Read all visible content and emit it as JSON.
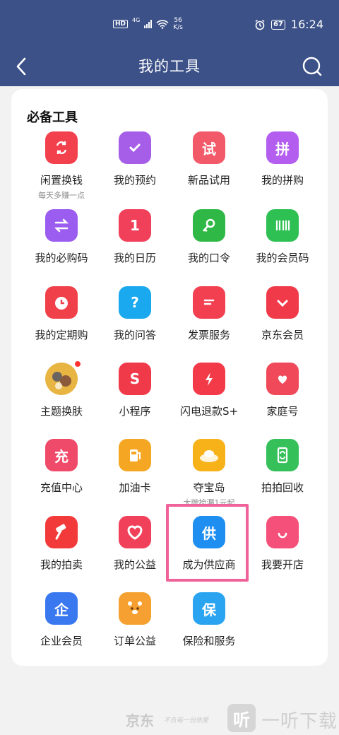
{
  "status_bar": {
    "hd": "HD",
    "network": "4G",
    "speed_value": "56",
    "speed_unit": "K/s",
    "battery": "67",
    "time": "16:24"
  },
  "nav": {
    "title": "我的工具",
    "back_icon": "chevron-left-icon",
    "search_icon": "search-icon",
    "bg_color": "#3c5188"
  },
  "section": {
    "title": "必备工具"
  },
  "tools": [
    {
      "label": "闲置换钱",
      "sub": "每天多赚一点",
      "icon": "recycle-bag-icon",
      "color": "#f2404d"
    },
    {
      "label": "我的预约",
      "icon": "calendar-check-icon",
      "color": "#a65ee8"
    },
    {
      "label": "新品试用",
      "glyph": "试",
      "icon": "trial-icon",
      "color": "#f25a6a"
    },
    {
      "label": "我的拼购",
      "glyph": "拼",
      "icon": "cart-icon",
      "color": "#b45ef0"
    },
    {
      "label": "我的必购码",
      "icon": "exchange-code-icon",
      "color": "#9b5cf0"
    },
    {
      "label": "我的日历",
      "glyph": "1",
      "icon": "calendar-icon",
      "color": "#f0405a"
    },
    {
      "label": "我的口令",
      "icon": "key-icon",
      "color": "#2fb845"
    },
    {
      "label": "我的会员码",
      "icon": "barcode-icon",
      "color": "#2fc054"
    },
    {
      "label": "我的定期购",
      "icon": "alarm-clock-icon",
      "color": "#f0404a"
    },
    {
      "label": "我的问答",
      "glyph": "?",
      "icon": "question-icon",
      "color": "#1aa8ee"
    },
    {
      "label": "发票服务",
      "icon": "invoice-icon",
      "color": "#f24050"
    },
    {
      "label": "京东会员",
      "icon": "heart-badge-icon",
      "color": "#f03a4a"
    },
    {
      "label": "主题换肤",
      "icon": "theme-avatar-icon",
      "color": "#e8b543"
    },
    {
      "label": "小程序",
      "glyph": "S",
      "icon": "mini-program-icon",
      "color": "#f03a4a"
    },
    {
      "label": "闪电退款S+",
      "icon": "lightning-shield-icon",
      "color": "#f23a48"
    },
    {
      "label": "家庭号",
      "icon": "home-heart-icon",
      "color": "#f04a5a"
    },
    {
      "label": "充值中心",
      "glyph": "充",
      "icon": "phone-recharge-icon",
      "color": "#f04a6a"
    },
    {
      "label": "加油卡",
      "icon": "fuel-pump-icon",
      "color": "#f5a623"
    },
    {
      "label": "夺宝岛",
      "sub": "大牌捡漏1元起",
      "icon": "gold-ingot-icon",
      "color": "#f7b21a"
    },
    {
      "label": "拍拍回收",
      "icon": "recycle-phone-icon",
      "color": "#35c05a"
    },
    {
      "label": "我的拍卖",
      "icon": "auction-hammer-icon",
      "color": "#f23a3a"
    },
    {
      "label": "我的公益",
      "icon": "charity-heart-icon",
      "color": "#f0405a"
    },
    {
      "label": "成为供应商",
      "glyph": "供",
      "icon": "supplier-icon",
      "color": "#1e8ef0"
    },
    {
      "label": "我要开店",
      "icon": "store-icon",
      "color": "#f5507a"
    },
    {
      "label": "企业会员",
      "glyph": "企",
      "icon": "enterprise-icon",
      "color": "#3a78f0"
    },
    {
      "label": "订单公益",
      "icon": "bear-icon",
      "color": "#f5a030"
    },
    {
      "label": "保险和服务",
      "glyph": "保",
      "icon": "insurance-shield-icon",
      "color": "#2aa4f0"
    }
  ],
  "watermark": {
    "jd": "京东",
    "slogan": "不负每一份热爱",
    "logo_glyph": "听",
    "site": "一听下载"
  }
}
